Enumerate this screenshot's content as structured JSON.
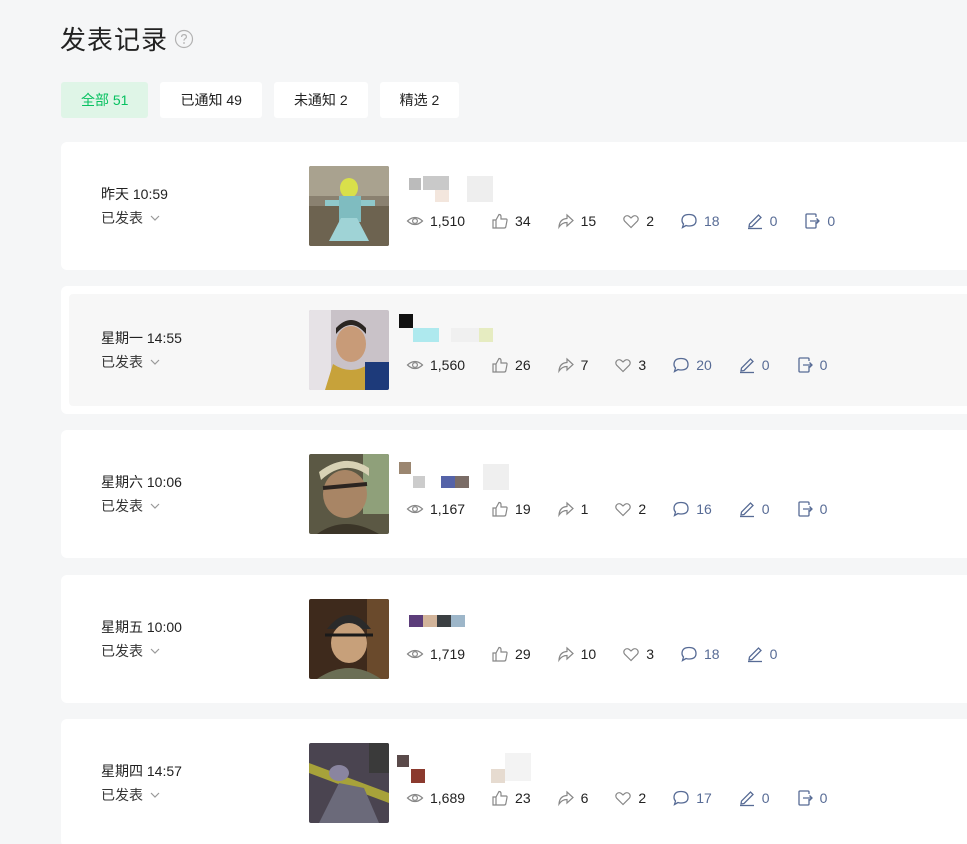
{
  "page": {
    "title": "发表记录"
  },
  "filters": [
    {
      "label": "全部 51",
      "active": true
    },
    {
      "label": "已通知 49",
      "active": false
    },
    {
      "label": "未通知 2",
      "active": false
    },
    {
      "label": "精选 2",
      "active": false
    }
  ],
  "records": [
    {
      "time": "昨天 10:59",
      "status": "已发表",
      "views": "1,510",
      "likes": "34",
      "shares": "15",
      "favorites": "2",
      "comments": "18",
      "edits": "0",
      "exports": "0",
      "has_export": true
    },
    {
      "time": "星期一 14:55",
      "status": "已发表",
      "views": "1,560",
      "likes": "26",
      "shares": "7",
      "favorites": "3",
      "comments": "20",
      "edits": "0",
      "exports": "0",
      "has_export": true
    },
    {
      "time": "星期六 10:06",
      "status": "已发表",
      "views": "1,167",
      "likes": "19",
      "shares": "1",
      "favorites": "2",
      "comments": "16",
      "edits": "0",
      "exports": "0",
      "has_export": true
    },
    {
      "time": "星期五 10:00",
      "status": "已发表",
      "views": "1,719",
      "likes": "29",
      "shares": "10",
      "favorites": "3",
      "comments": "18",
      "edits": "0",
      "exports": "",
      "has_export": false
    },
    {
      "time": "星期四 14:57",
      "status": "已发表",
      "views": "1,689",
      "likes": "23",
      "shares": "6",
      "favorites": "2",
      "comments": "17",
      "edits": "0",
      "exports": "0",
      "has_export": true
    }
  ],
  "colors": {
    "accent": "#07c160",
    "accent_bg": "#dff5e7",
    "link_blue": "#576b95"
  }
}
